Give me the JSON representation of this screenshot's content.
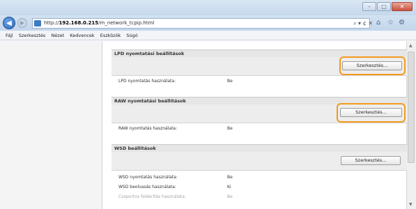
{
  "browser": {
    "url_prefix": "http://",
    "url_host": "192.168.0.215",
    "url_path": "/m_network_tcpip.html",
    "address_controls": "⌕ ▾ ¢ ✕",
    "window_controls": [
      "–",
      "□",
      "✕"
    ],
    "toolbar_icons": [
      "⌂",
      "☆",
      "⚙"
    ]
  },
  "menubar": [
    "Fájl",
    "Szerkesztés",
    "Nézet",
    "Kedvencek",
    "Eszközök",
    "Súgó"
  ],
  "sections": [
    {
      "title": "LPD nyomtatási beállítások",
      "edit_label": "Szerkesztés...",
      "rows": [
        {
          "label": "LPD nyomtatás használata:",
          "value": "Be"
        }
      ]
    },
    {
      "title": "RAW nyomtatási beállítások",
      "edit_label": "Szerkesztés...",
      "rows": [
        {
          "label": "RAW nyomtatás használata:",
          "value": "Be"
        }
      ]
    },
    {
      "title": "WSD beállítások",
      "edit_label": "Szerkesztés...",
      "rows": [
        {
          "label": "WSD nyomtatás használata:",
          "value": "Be"
        },
        {
          "label": "WSD beolvasás használata:",
          "value": "Ki"
        },
        {
          "label": "Csoportos felderítés használata:",
          "value": "Be"
        }
      ]
    }
  ],
  "colors": {
    "highlight": "#f29a1d",
    "chrome": "#c6d8ec",
    "back_button": "#2f6fc0"
  }
}
